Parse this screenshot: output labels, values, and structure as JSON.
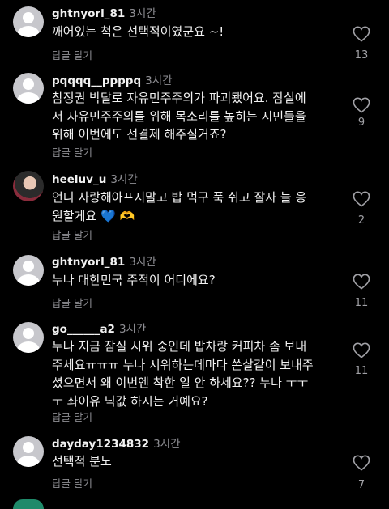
{
  "comments": [
    {
      "username": "ghtnyorl_81",
      "time": "3시간",
      "text": "깨어있는 척은 선택적이였군요 ~!",
      "reply": "답글 달기",
      "likes": "13"
    },
    {
      "username": "pqqqq__ppppq",
      "time": "3시간",
      "text": "참정권 박탈로 자유민주주의가 파괴됐어요. 잠실에\n서 자유민주주의를 위해 목소리를 높히는 시민들을\n위해 이번에도 선결제 해주실거죠?",
      "reply": "답글 달기",
      "likes": "9"
    },
    {
      "username": "heeluv_u",
      "time": "3시간",
      "text_before": "언니 사랑해아프지말고 밥 먹구 푹 쉬고 잘자 늘 응\n원할게요 ",
      "emoji_heart": "💙",
      "emoji_hands": "🫶",
      "reply": "답글 달기",
      "likes": "2"
    },
    {
      "username": "ghtnyorl_81",
      "time": "3시간",
      "text": "누나 대한민국 주적이 어디에요?",
      "reply": "답글 달기",
      "likes": "11"
    },
    {
      "username": "go______a2",
      "time": "3시간",
      "text": "누나 지금 잠실 시위 중인데 밥차랑 커피차 좀 보내\n주세요ㅠㅠㅠ 누나 시위하는데마다 쏜살같이 보내주\n셨으면서 왜 이번엔 착한 일 안 하세요?? 누나 ㅜㅜ\nㅜ 좌이유 닉값 하시는 거예요?",
      "reply": "답글 달기",
      "likes": "11"
    },
    {
      "username": "dayday1234832",
      "time": "3시간",
      "text": "선택적 분노",
      "reply": "답글 달기",
      "likes": "7"
    }
  ],
  "icons": {
    "avatar": "default-avatar-icon",
    "like": "heart-outline-icon"
  },
  "colors": {
    "background": "#000000",
    "text": "#f2f2f2",
    "secondary": "#8e8e93",
    "avatar": "#c7c7cc",
    "emoji_heart": "#2b7fff"
  }
}
